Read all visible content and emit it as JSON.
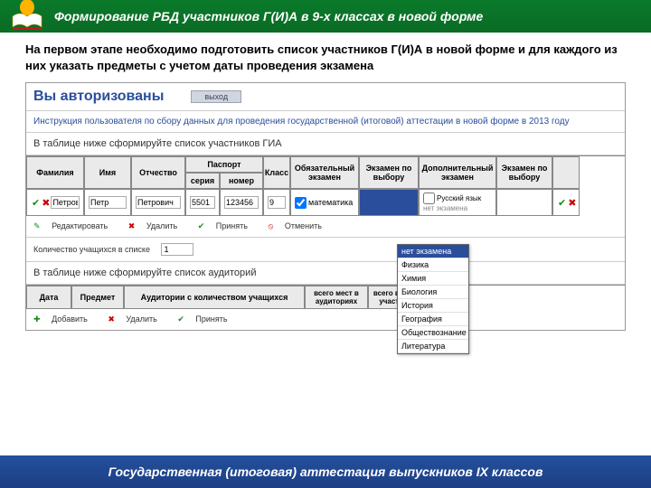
{
  "header": {
    "title": "Формирование РБД участников Г(И)А в 9-х классах в новой форме"
  },
  "instruction": "На первом этапе необходимо подготовить список участников Г(И)А в новой форме и для каждого из них указать предметы с учетом даты проведения экзамена",
  "auth": {
    "label": "Вы авторизованы",
    "exit": "выход"
  },
  "info": "Инструкция пользователя по сбору данных для проведения государственной (итоговой) аттестации в новой форме в 2013 году",
  "table1_caption": "В таблице ниже сформируйте список участников ГИА",
  "t1": {
    "headers": {
      "surname": "Фамилия",
      "name": "Имя",
      "patronymic": "Отчество",
      "passport": "Паспорт",
      "series": "серия",
      "number": "номер",
      "class": "Класс",
      "exam_req": "Обязательный экзамен",
      "exam_choice": "Экзамен по выбору",
      "exam_add": "Дополнительный экзамен",
      "exam_choice2": "Экзамен по выбору"
    },
    "row": {
      "surname": "Петров",
      "name": "Петр",
      "patronymic": "Петрович",
      "series": "5501",
      "number": "123456",
      "class": "9",
      "exam_req": "математика",
      "exam_add_rus": "Русский язык",
      "exam_add_none": "нет экзамена"
    }
  },
  "dropdown": [
    "нет экзамена",
    "Физика",
    "Химия",
    "Биология",
    "История",
    "География",
    "Обществознание",
    "Литература"
  ],
  "actions1": {
    "edit": "Редактировать",
    "del": "Удалить",
    "accept": "Принять",
    "cancel": "Отменить"
  },
  "count": {
    "label": "Количество учащихся в списке",
    "value": "1"
  },
  "table2_caption": "В таблице ниже сформируйте список аудиторий",
  "t2": {
    "headers": {
      "date": "Дата",
      "subject": "Предмет",
      "aud": "Аудитории с количеством учащихся",
      "places": "всего мест в аудиториях",
      "inlist": "всего в списке участников"
    }
  },
  "actions2": {
    "add": "Добавить",
    "del": "Удалить",
    "accept": "Принять"
  },
  "footer": "Государственная (итоговая) аттестация выпускников IX классов"
}
